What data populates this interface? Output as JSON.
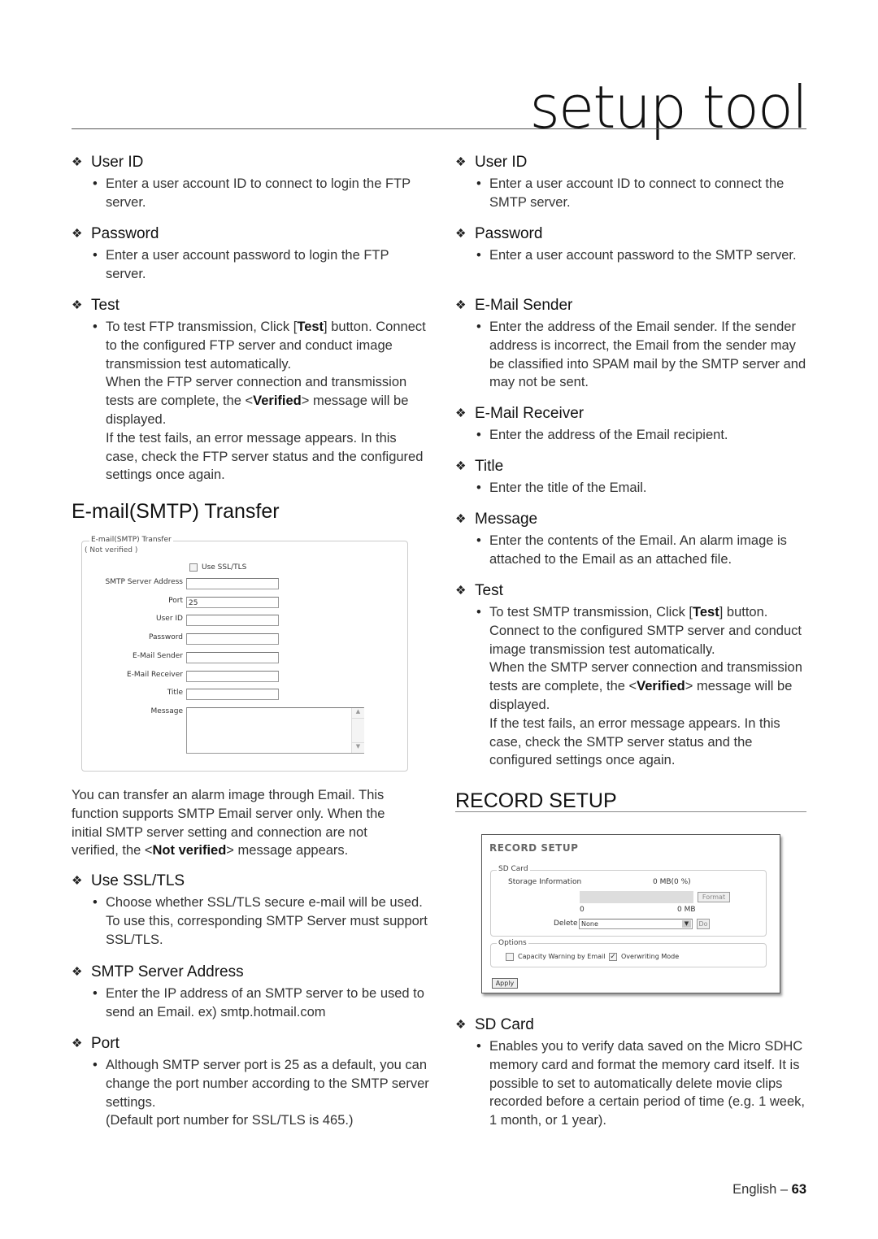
{
  "header": {
    "title": "setup tool"
  },
  "left_column": {
    "ftp_items": [
      {
        "heading": "User ID",
        "paragraphs": [
          "Enter a user account ID to connect to login the FTP server."
        ]
      },
      {
        "heading": "Password",
        "paragraphs": [
          "Enter a user account password to login the FTP server."
        ]
      },
      {
        "heading": "Test",
        "paragraphs": [
          "To test FTP transmission, Click [Test] button. Connect to the configured FTP server and conduct image transmission test automatically.",
          "When the FTP server connection and transmission tests are complete, the <Verified> message will be displayed.",
          "If the test fails, an error message appears. In this case, check the FTP server status and the configured settings once again."
        ]
      }
    ],
    "section_title": "E-mail(SMTP) Transfer",
    "intro_parts": [
      "You can transfer an alarm image through Email. This function supports SMTP Email server only. When the initial SMTP server setting and connection are not verified, the <",
      "Not verified",
      "> message appears."
    ],
    "smtp_items": [
      {
        "heading": "Use SSL/TLS",
        "paragraphs": [
          "Choose whether SSL/TLS secure e-mail will be used. To use this, corresponding SMTP Server must support SSL/TLS."
        ]
      },
      {
        "heading": "SMTP Server Address",
        "paragraphs": [
          "Enter the IP address of an SMTP server to be used to send an Email. ex) smtp.hotmail.com"
        ]
      },
      {
        "heading": "Port",
        "paragraphs": [
          "Although SMTP server port is 25 as a default, you can change the port number according to the SMTP server settings.",
          "(Default port number for SSL/TLS is 465.)"
        ]
      }
    ]
  },
  "smtp_panel": {
    "legend": "E-mail(SMTP) Transfer",
    "status": "( Not verified )",
    "use_ssl_label": "Use SSL/TLS",
    "use_ssl_checked": false,
    "fields": [
      {
        "label": "SMTP Server Address",
        "value": ""
      },
      {
        "label": "Port",
        "value": "25"
      },
      {
        "label": "User ID",
        "value": ""
      },
      {
        "label": "Password",
        "value": ""
      },
      {
        "label": "E-Mail Sender",
        "value": ""
      },
      {
        "label": "E-Mail Receiver",
        "value": ""
      },
      {
        "label": "Title",
        "value": ""
      }
    ],
    "message_label": "Message",
    "message_value": ""
  },
  "right_column": {
    "smtp_items": [
      {
        "heading": "User ID",
        "paragraphs": [
          "Enter a user account ID to connect to connect the SMTP server."
        ]
      },
      {
        "heading": "Password",
        "paragraphs": [
          "Enter a user account password to the SMTP server."
        ]
      },
      {
        "heading": "E-Mail Sender",
        "paragraphs": [
          "Enter the address of the Email sender. If the sender address is incorrect, the Email from the sender may be classified into SPAM mail by the SMTP server and may not be sent."
        ]
      },
      {
        "heading": "E-Mail Receiver",
        "paragraphs": [
          "Enter the address of the Email recipient."
        ]
      },
      {
        "heading": "Title",
        "paragraphs": [
          "Enter the title of the Email."
        ]
      },
      {
        "heading": "Message",
        "paragraphs": [
          "Enter the contents of the Email. An alarm image is attached to the Email as an attached file."
        ]
      },
      {
        "heading": "Test",
        "paragraphs": [
          "To test SMTP transmission, Click [Test] button. Connect to the configured SMTP server and conduct image transmission test automatically.",
          "When the SMTP server connection and transmission tests are complete, the <Verified> message will be displayed.",
          "If the test fails, an error message appears. In this case, check the SMTP server status and the configured settings once again."
        ]
      }
    ],
    "section_title": "RECORD SETUP",
    "record_items": [
      {
        "heading": "SD Card",
        "paragraphs": [
          "Enables you to verify data saved on the Micro SDHC memory card and format the memory card itself. It is possible to set to automatically delete movie clips recorded before a certain period of time (e.g. 1 week, 1 month, or 1 year)."
        ]
      }
    ]
  },
  "record_panel": {
    "title": "RECORD SETUP",
    "sd_legend": "SD Card",
    "storage_label": "Storage Information",
    "storage_value": "0 MB(0 %)",
    "usage_percent": 0,
    "format_button": "Format",
    "range_min": "0",
    "range_max": "0 MB",
    "delete_label": "Delete",
    "delete_value": "None",
    "do_button": "Do",
    "options_legend": "Options",
    "capacity_warning_label": "Capacity Warning by Email",
    "capacity_warning_checked": false,
    "overwriting_label": "Overwriting Mode",
    "overwriting_checked": true,
    "apply_button": "Apply"
  },
  "footer": {
    "language": "English",
    "separator": "–",
    "page": "63"
  }
}
